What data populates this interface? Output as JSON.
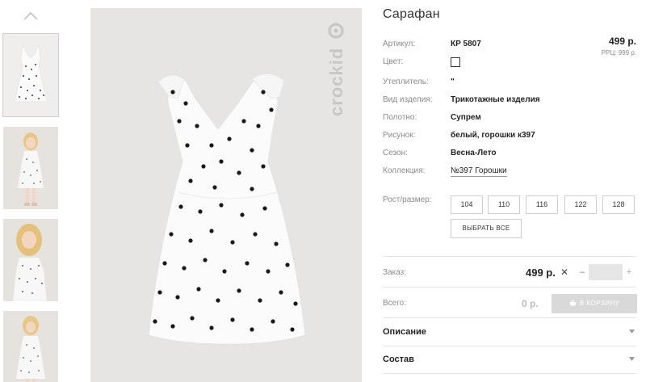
{
  "product": {
    "title": "Сарафан",
    "price": "499 р.",
    "rrp": "РРЦ: 999 р.",
    "attributes": [
      {
        "label": "Артикул:",
        "value": "КР 5807"
      },
      {
        "label": "Цвет:",
        "value": ""
      },
      {
        "label": "Утеплитель:",
        "value": "\""
      },
      {
        "label": "Вид изделия:",
        "value": "Трикотажные изделия"
      },
      {
        "label": "Полотно:",
        "value": "Супрем"
      },
      {
        "label": "Рисунок:",
        "value": "белый, горошки к397"
      },
      {
        "label": "Сезон:",
        "value": "Весна-Лето"
      },
      {
        "label": "Коллекция:",
        "value": "№397 Горошки"
      }
    ],
    "size_label": "Рост/размер:",
    "sizes": [
      "104",
      "110",
      "116",
      "122",
      "128"
    ],
    "select_all": "ВЫБРАТЬ ВСЕ"
  },
  "order": {
    "label": "Заказ:",
    "price": "499 р.",
    "times": "✕",
    "minus": "–",
    "plus": "+",
    "quantity": ""
  },
  "total": {
    "label": "Всего:",
    "value": "0 р.",
    "cart_button": "В КОРЗИНУ"
  },
  "accordion": [
    {
      "label": "Описание"
    },
    {
      "label": "Состав"
    }
  ],
  "colors": {
    "accent_disabled": "#d9d9d9",
    "image_bg": "#e7e5e3",
    "dot": "#1a1a1a"
  },
  "icons": {
    "thumb_up": "chevron-up-icon",
    "cart": "basket-icon",
    "accordion": "triangle-down-icon"
  }
}
